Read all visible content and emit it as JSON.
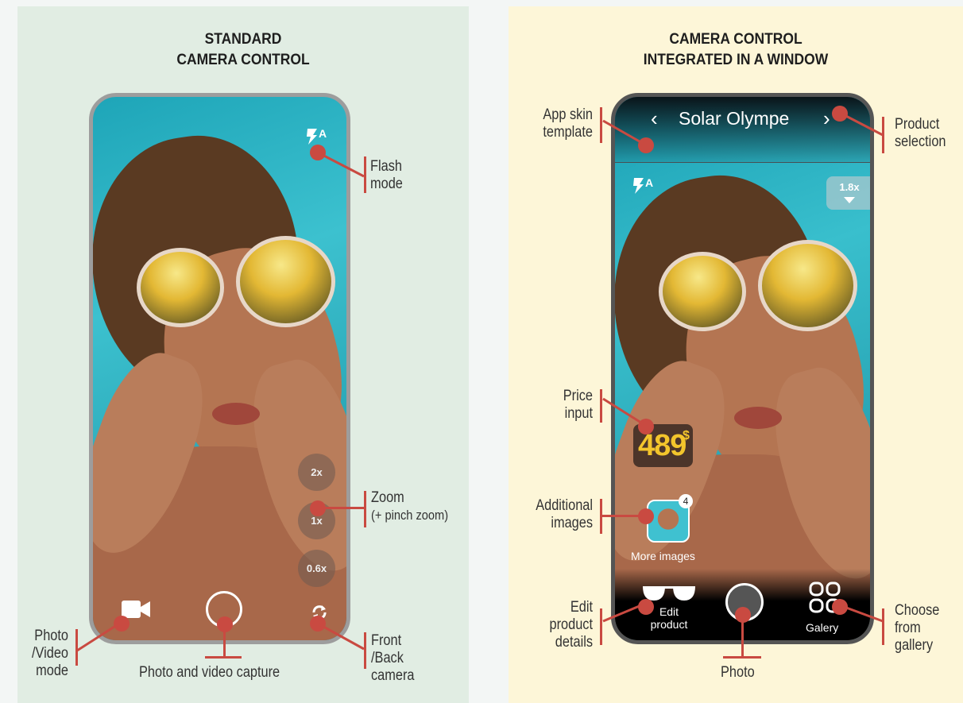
{
  "left": {
    "title_line1": "STANDARD",
    "title_line2": "CAMERA CONTROL",
    "flash_label_1": "Flash",
    "flash_label_2": "mode",
    "zoom_label": "Zoom",
    "zoom_sublabel": "(+ pinch zoom)",
    "zoom_levels": [
      "2x",
      "1x",
      "0.6x"
    ],
    "mode_label": [
      "Photo",
      "/Video",
      "mode"
    ],
    "capture_label": "Photo and video capture",
    "camera_label": [
      "Front",
      "/Back",
      "camera"
    ],
    "flash_icon_letter": "A"
  },
  "right": {
    "title_line1": "CAMERA CONTROL",
    "title_line2": "INTEGRATED IN A WINDOW",
    "product_name": "Solar Olympe",
    "skin_label": [
      "App skin",
      "template"
    ],
    "product_selection_label": [
      "Product",
      "selection"
    ],
    "zoom_value": "1.8x",
    "price_label": [
      "Price",
      "input"
    ],
    "price_value": "489",
    "price_currency": "$",
    "additional_label": [
      "Additional",
      "images"
    ],
    "images_count": "4",
    "more_images": "More images",
    "edit_label": [
      "Edit",
      "product",
      "details"
    ],
    "edit_button": [
      "Edit",
      "product"
    ],
    "gallery_button": "Galery",
    "gallery_label": [
      "Choose",
      "from",
      "gallery"
    ],
    "photo_label": "Photo",
    "flash_icon_letter": "A"
  },
  "colors": {
    "accent": "#c94a41",
    "left_bg": "#e1ede3",
    "right_bg": "#fdf6d8",
    "price": "#f3c52c"
  },
  "icons": [
    "flash-auto-icon",
    "video-camera-icon",
    "switch-camera-icon",
    "chevron-left-icon",
    "chevron-right-icon",
    "chevron-down-icon",
    "sunglasses-icon",
    "gallery-grid-icon"
  ]
}
